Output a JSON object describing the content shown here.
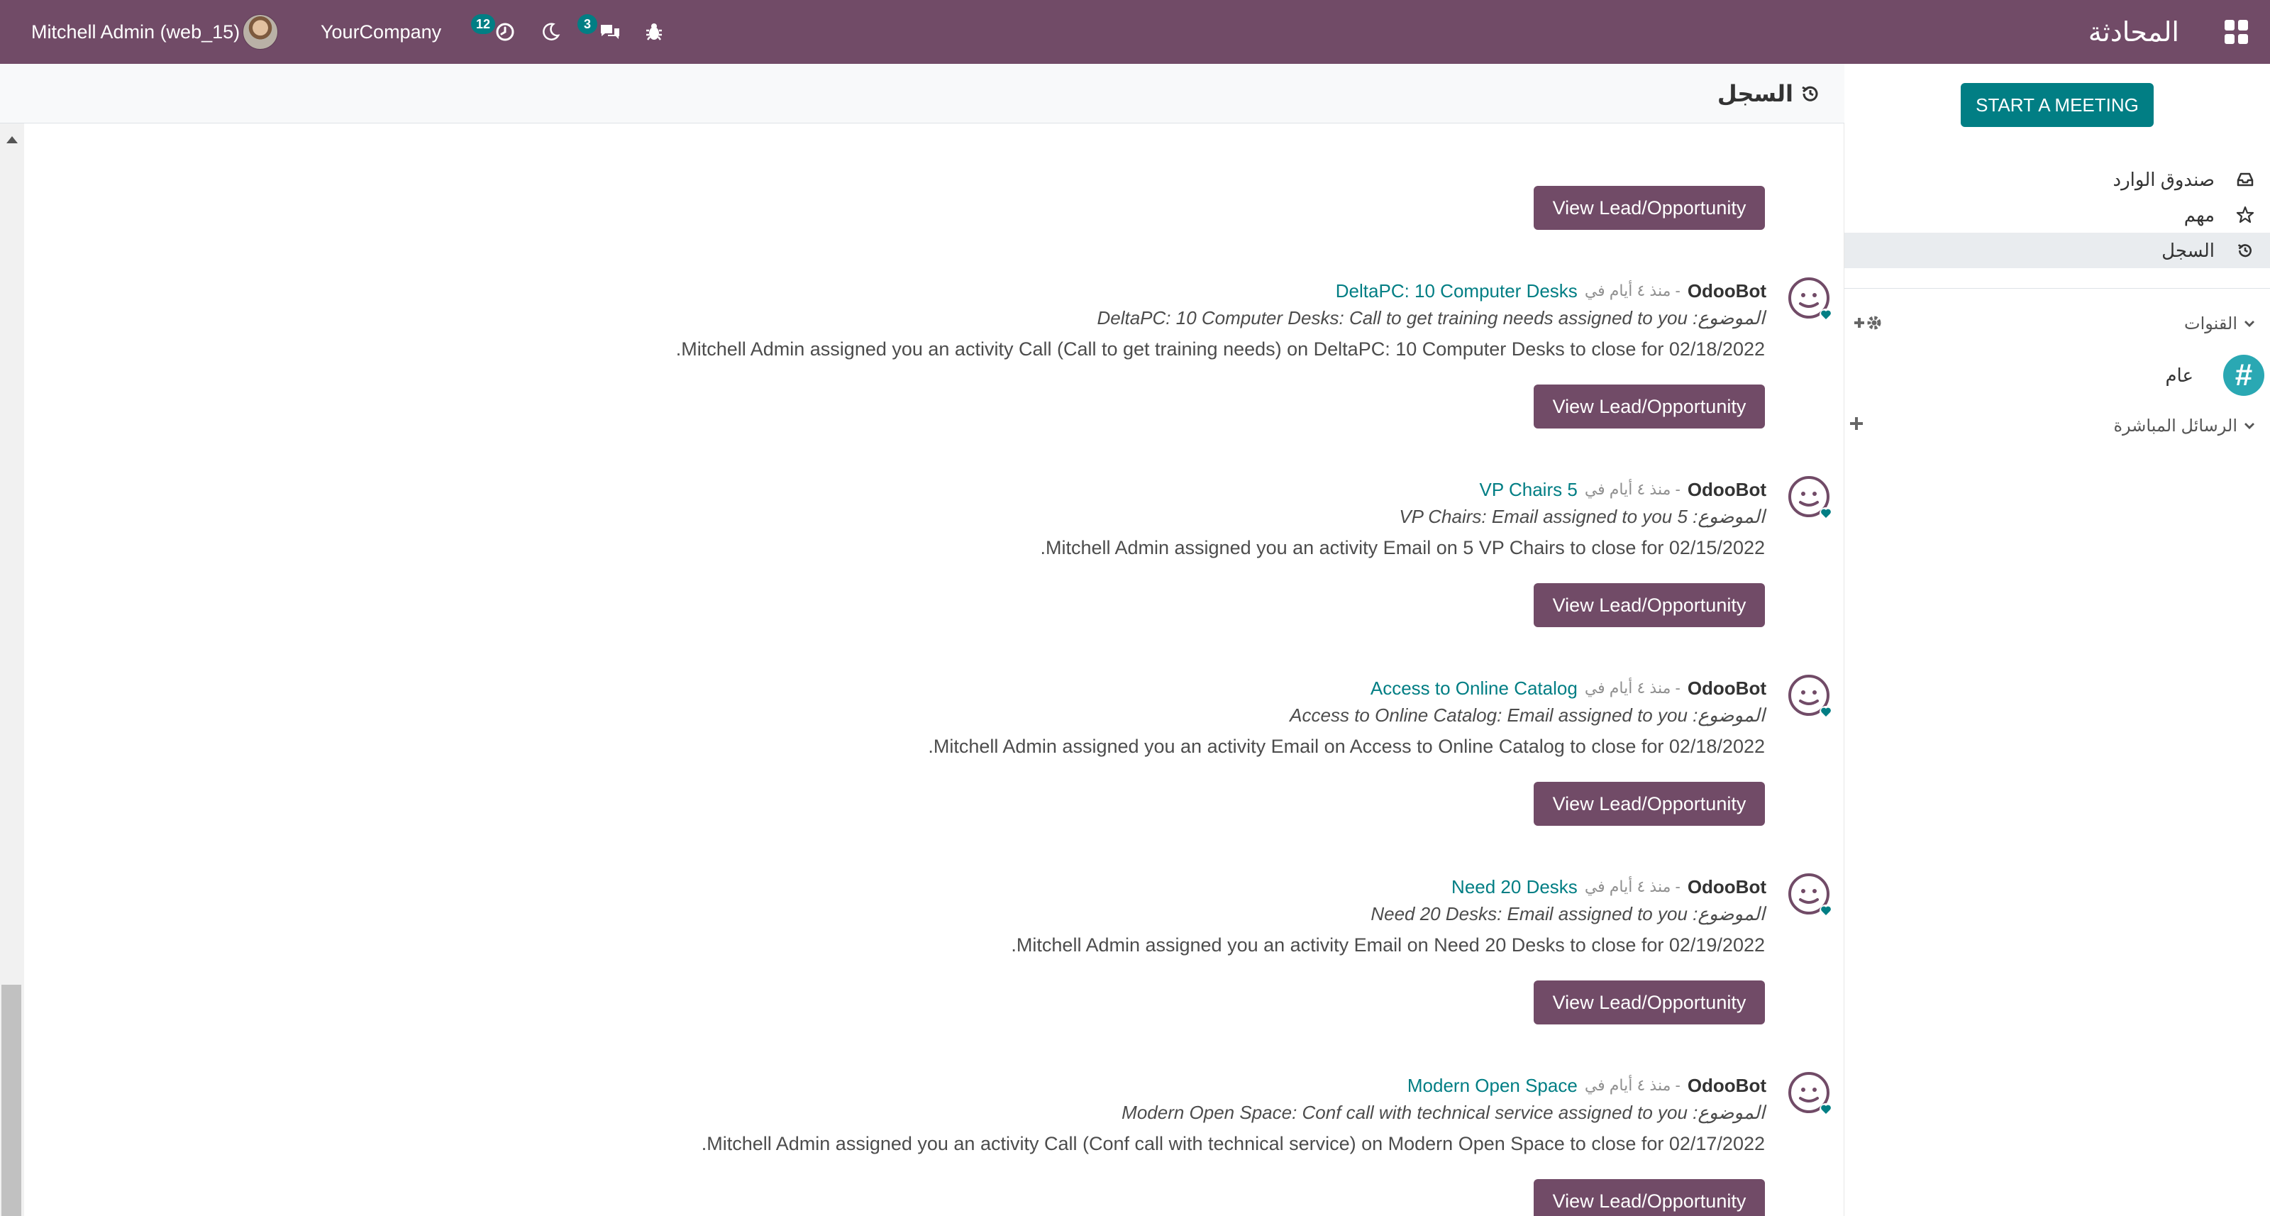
{
  "navbar": {
    "user_name": "Mitchell Admin (web_15)",
    "company": "YourCompany",
    "activity_count": "12",
    "message_count": "3",
    "app_title": "المحادثة",
    "icons": [
      "apps-grid-icon",
      "clock-icon",
      "moon-icon",
      "chat-bubbles-icon",
      "bug-icon"
    ]
  },
  "main": {
    "title": "السجل",
    "title_icon": "history-icon",
    "top_button": "View Lead/Opportunity",
    "messages": [
      {
        "author": "OdooBot",
        "date": "- منذ ٤ أيام في",
        "record": "DeltaPC: 10 Computer Desks",
        "subject": "الموضوع: DeltaPC: 10 Computer Desks: Call to get training needs assigned to you",
        "body": "Mitchell Admin assigned you an activity Call (Call to get training needs) on DeltaPC: 10 Computer Desks to close for 02/18/2022.",
        "button": "View Lead/Opportunity"
      },
      {
        "author": "OdooBot",
        "date": "- منذ ٤ أيام في",
        "record": "VP Chairs 5",
        "subject": "الموضوع: 5 VP Chairs: Email assigned to you",
        "body": "Mitchell Admin assigned you an activity Email on 5 VP Chairs to close for 02/15/2022.",
        "button": "View Lead/Opportunity"
      },
      {
        "author": "OdooBot",
        "date": "- منذ ٤ أيام في",
        "record": "Access to Online Catalog",
        "subject": "الموضوع: Access to Online Catalog: Email assigned to you",
        "body": "Mitchell Admin assigned you an activity Email on Access to Online Catalog to close for 02/18/2022.",
        "button": "View Lead/Opportunity"
      },
      {
        "author": "OdooBot",
        "date": "- منذ ٤ أيام في",
        "record": "Need 20 Desks",
        "subject": "الموضوع: Need 20 Desks: Email assigned to you",
        "body": "Mitchell Admin assigned you an activity Email on Need 20 Desks to close for 02/19/2022.",
        "button": "View Lead/Opportunity"
      },
      {
        "author": "OdooBot",
        "date": "- منذ ٤ أيام في",
        "record": "Modern Open Space",
        "subject": "الموضوع: Modern Open Space: Conf call with technical service assigned to you",
        "body": "Mitchell Admin assigned you an activity Call (Conf call with technical service) on Modern Open Space to close for 02/17/2022.",
        "button": "View Lead/Opportunity"
      }
    ]
  },
  "sidebar": {
    "start_meeting": "START A MEETING",
    "items": [
      {
        "label": "صندوق الوارد",
        "icon": "inbox-icon"
      },
      {
        "label": "مهم",
        "icon": "star-icon"
      },
      {
        "label": "السجل",
        "icon": "history-icon",
        "active": true
      }
    ],
    "channels_label": "القنوات",
    "channel_general": "عام",
    "direct_messages_label": "الرسائل المباشرة"
  },
  "colors": {
    "brand": "#714b67",
    "accent": "#017e84",
    "active_item": "#e9ecef"
  }
}
